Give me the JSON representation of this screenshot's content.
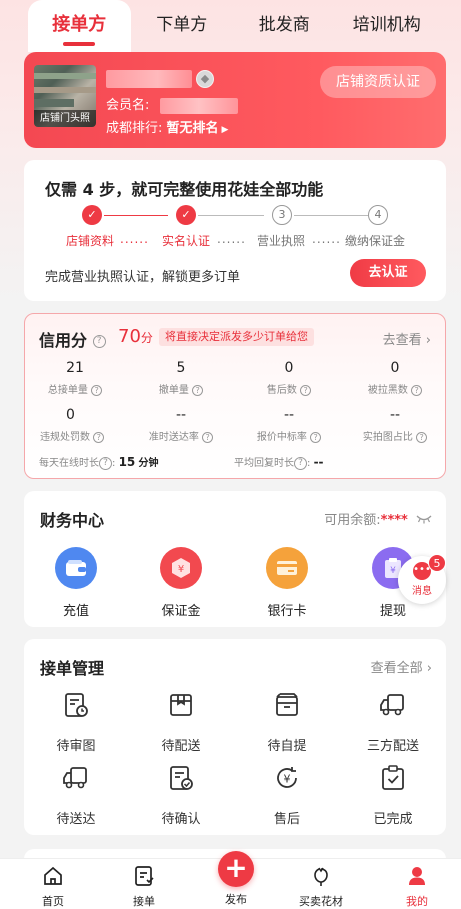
{
  "tabs": [
    "接单方",
    "下单方",
    "批发商",
    "培训机构"
  ],
  "shop": {
    "photo_caption": "店铺门头照",
    "member_label": "会员名:",
    "member_tail": "",
    "rank_label": "成都排行:",
    "rank_value": "暂无排名",
    "qual_button": "店铺资质认证"
  },
  "steps": {
    "title": "仅需 4 步，就可完整使用花娃全部功能",
    "labels": [
      "店铺资料",
      "实名认证",
      "营业执照",
      "缴纳保证金"
    ],
    "todo_numbers": [
      "3",
      "4"
    ],
    "tip": "完成营业执照认证，解锁更多订单",
    "button": "去认证"
  },
  "credit": {
    "title": "信用分",
    "score": "70",
    "score_unit": "分",
    "tag": "将直接决定派发多少订单给您",
    "more": "去查看 ",
    "metrics": [
      {
        "value": "21",
        "label": "总接单量"
      },
      {
        "value": "5",
        "label": "撤单量"
      },
      {
        "value": "0",
        "label": "售后数"
      },
      {
        "value": "0",
        "label": "被拉黑数"
      },
      {
        "value": "0",
        "label": "违规处罚数"
      },
      {
        "value": "--",
        "label": "准时送达率"
      },
      {
        "value": "--",
        "label": "报价中标率"
      },
      {
        "value": "--",
        "label": "实拍图占比"
      }
    ],
    "online_label": "每天在线时长",
    "online_value": "15",
    "online_unit": "分钟",
    "reply_label": "平均回复时长",
    "reply_value": "--"
  },
  "finance": {
    "title": "财务中心",
    "balance_label": "可用余额:",
    "balance_value": "****",
    "items": [
      "充值",
      "保证金",
      "银行卡",
      "提现"
    ],
    "colors": [
      "#4f88f0",
      "#f2494f",
      "#f5a23b",
      "#8b6cf0"
    ]
  },
  "message": {
    "label": "消息",
    "badge": "5"
  },
  "orders": {
    "title": "接单管理",
    "more": "查看全部 ",
    "items": [
      "待审图",
      "待配送",
      "待自提",
      "三方配送",
      "待送达",
      "待确认",
      "售后",
      "已完成"
    ]
  },
  "nav": {
    "items": [
      "首页",
      "接单",
      "发布",
      "买卖花材",
      "我的"
    ],
    "active": "我的"
  },
  "accent": "#e8303b"
}
